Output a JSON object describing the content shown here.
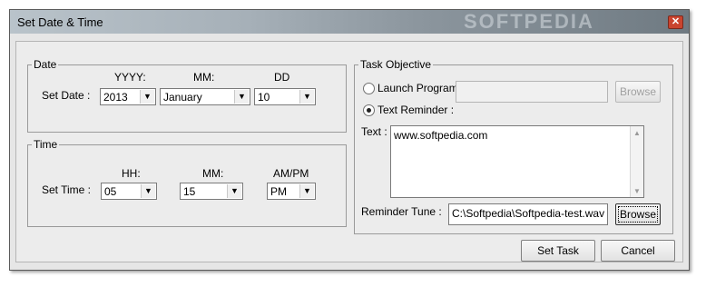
{
  "window": {
    "title": "Set Date & Time",
    "watermark": "SOFTPEDIA"
  },
  "date_group": {
    "legend": "Date",
    "yyyy_header": "YYYY:",
    "mm_header": "MM:",
    "dd_header": "DD",
    "set_label": "Set Date :",
    "year": "2013",
    "month": "January",
    "day": "10"
  },
  "time_group": {
    "legend": "Time",
    "hh_header": "HH:",
    "mm_header": "MM:",
    "ampm_header": "AM/PM",
    "set_label": "Set Time :",
    "hour": "05",
    "minute": "15",
    "ampm": "PM"
  },
  "task_group": {
    "legend": "Task Objective",
    "launch_label": "Launch Program",
    "launch_selected": false,
    "reminder_label": "Text Reminder :",
    "reminder_selected": true,
    "program_path": "",
    "browse_program": "Browse",
    "text_label": "Text :",
    "text_value": "www.softpedia.com",
    "tune_label": "Reminder Tune :",
    "tune_value": "C:\\Softpedia\\Softpedia-test.wav",
    "browse_tune": "Browse"
  },
  "buttons": {
    "set_task": "Set Task",
    "cancel": "Cancel"
  },
  "icons": {
    "close": "close-icon",
    "dropdown": "chevron-down-icon"
  }
}
